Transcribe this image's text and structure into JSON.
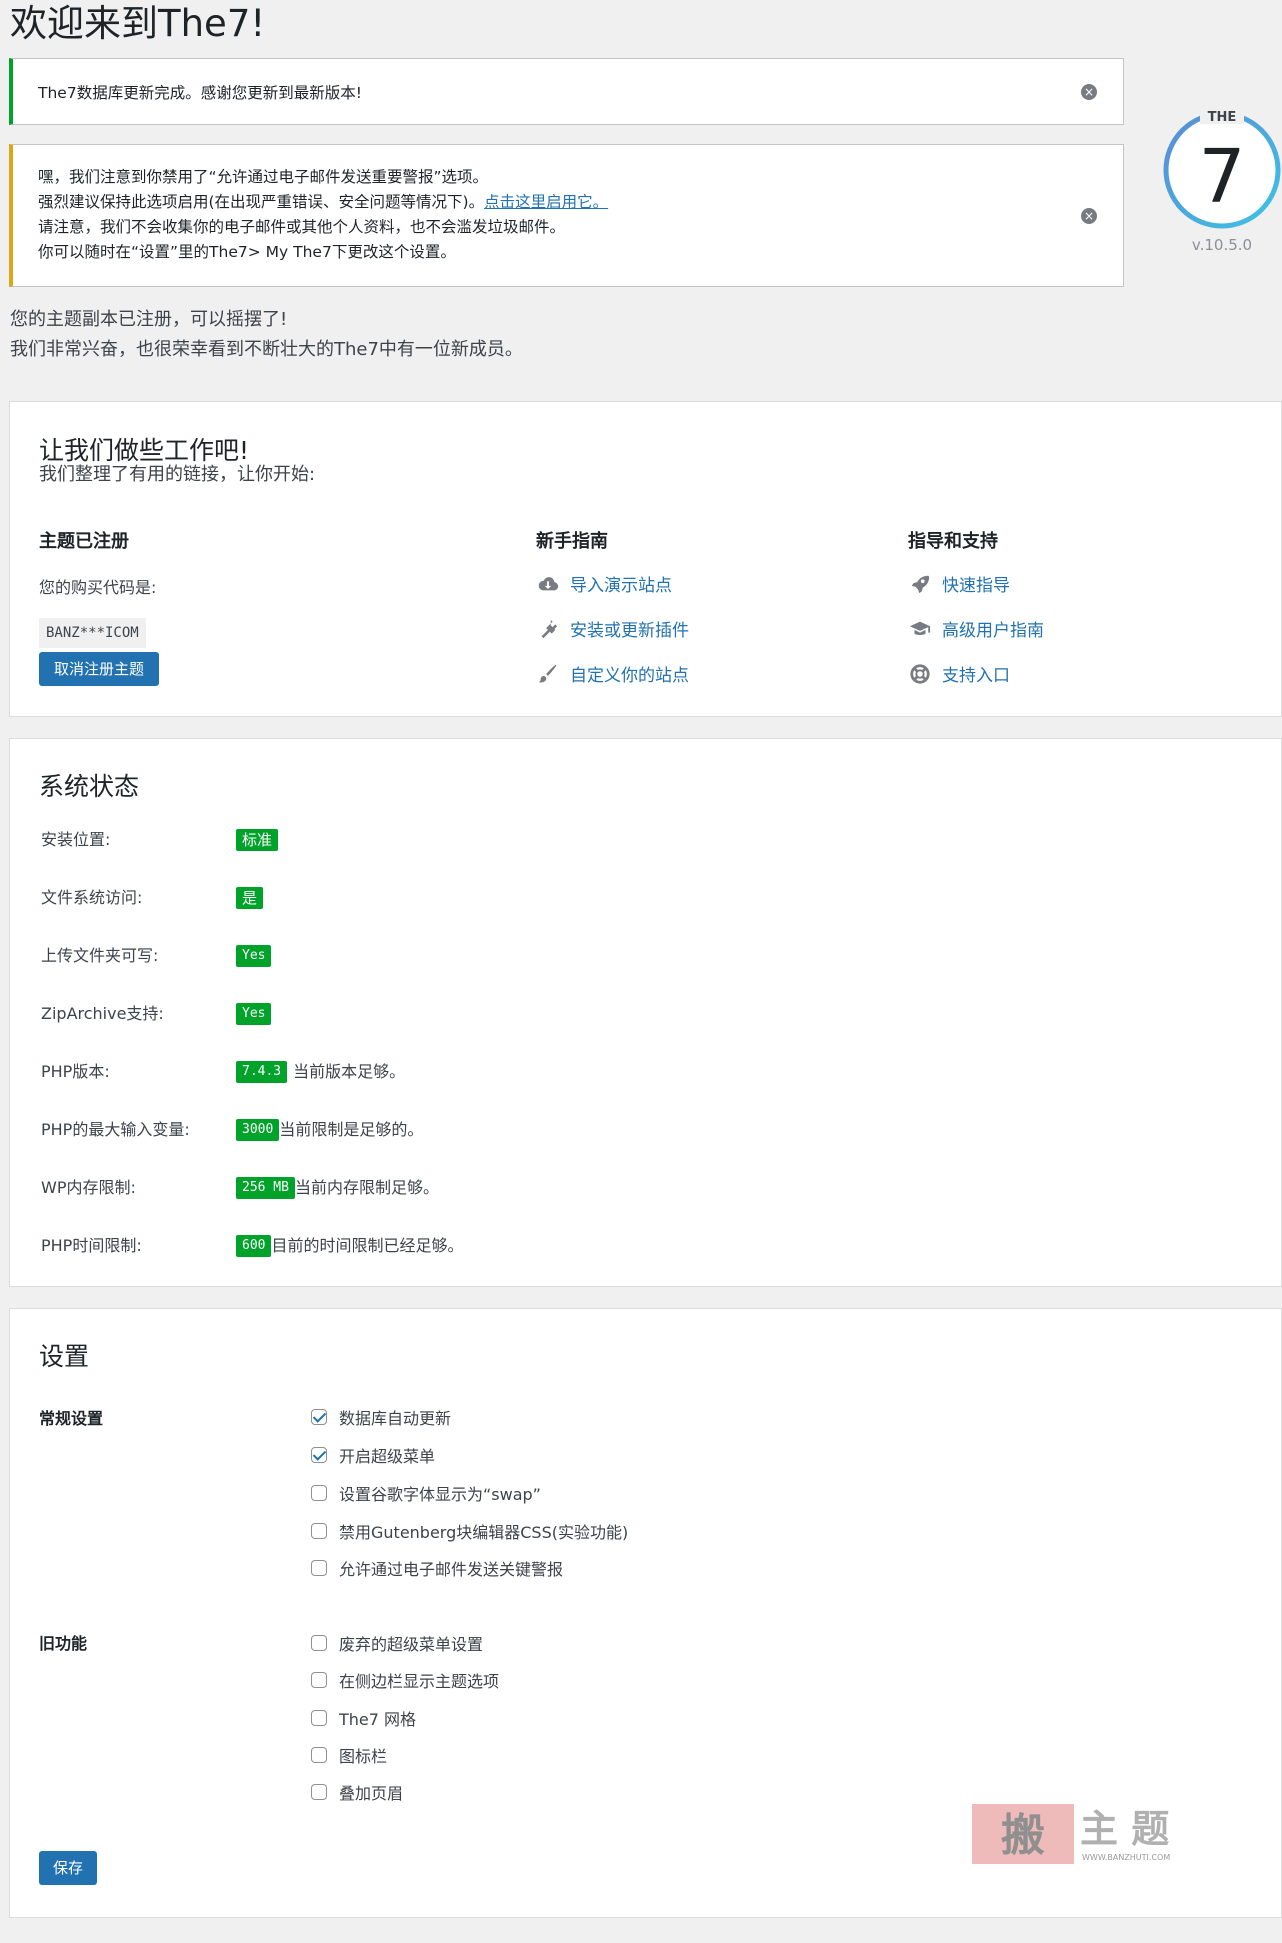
{
  "page": {
    "title": "欢迎来到The7!"
  },
  "logo": {
    "brand": "THE",
    "digit": "7",
    "version": "v.10.5.0"
  },
  "notices": {
    "success": {
      "text": "The7数据库更新完成。感谢您更新到最新版本!"
    },
    "warning": {
      "line1": "嘿，我们注意到你禁用了“允许通过电子邮件发送重要警报”选项。",
      "line2_pre": "强烈建议保持此选项启用(在出现严重错误、安全问题等情况下)。",
      "line2_link": "点击这里启用它。",
      "line3": "请注意，我们不会收集你的电子邮件或其他个人资料，也不会滥发垃圾邮件。",
      "line4": "你可以随时在“设置”里的The7> My The7下更改这个设置。"
    },
    "dismiss_glyph": "×"
  },
  "intro": {
    "line1": "您的主题副本已注册，可以摇摆了!",
    "line2": "我们非常兴奋，也很荣幸看到不断壮大的The7中有一位新成员。"
  },
  "work": {
    "title": "让我们做些工作吧!",
    "subtitle": "我们整理了有用的链接，让你开始:",
    "registered": {
      "heading": "主题已注册",
      "code_label": "您的购买代码是:",
      "code": "BANZ***ICOM",
      "button": "取消注册主题"
    },
    "guide": {
      "heading": "新手指南",
      "links": [
        {
          "label": "导入演示站点",
          "icon": "cloud-download-icon"
        },
        {
          "label": "安装或更新插件",
          "icon": "plugin-icon"
        },
        {
          "label": "自定义你的站点",
          "icon": "brush-icon"
        }
      ]
    },
    "support": {
      "heading": "指导和支持",
      "links": [
        {
          "label": "快速指导",
          "icon": "rocket-icon"
        },
        {
          "label": "高级用户指南",
          "icon": "graduation-cap-icon"
        },
        {
          "label": "支持入口",
          "icon": "lifebuoy-icon"
        }
      ]
    }
  },
  "status": {
    "title": "系统状态",
    "rows": [
      {
        "label": "安装位置:",
        "badge": "标准",
        "note": ""
      },
      {
        "label": "文件系统访问:",
        "badge": "是",
        "note": ""
      },
      {
        "label": "上传文件夹可写:",
        "badge": "Yes",
        "note": ""
      },
      {
        "label": "ZipArchive支持:",
        "badge": "Yes",
        "note": ""
      },
      {
        "label": "PHP版本:",
        "badge": "7.4.3",
        "note": "当前版本足够。"
      },
      {
        "label": "PHP的最大输入变量:",
        "badge": "3000",
        "note": "当前限制是足够的。"
      },
      {
        "label": "WP内存限制:",
        "badge": "256 MB",
        "note": "当前内存限制足够。"
      },
      {
        "label": "PHP时间限制:",
        "badge": "600",
        "note": "目前的时间限制已经足够。"
      }
    ]
  },
  "settings": {
    "title": "设置",
    "general": {
      "label": "常规设置",
      "options": [
        {
          "label": "数据库自动更新",
          "checked": true
        },
        {
          "label": "开启超级菜单",
          "checked": true
        },
        {
          "label": "设置谷歌字体显示为“swap”",
          "checked": false
        },
        {
          "label": "禁用Gutenberg块编辑器CSS(实验功能)",
          "checked": false
        },
        {
          "label": "允许通过电子邮件发送关键警报",
          "checked": false
        }
      ]
    },
    "legacy": {
      "label": "旧功能",
      "options": [
        {
          "label": "废弃的超级菜单设置",
          "checked": false
        },
        {
          "label": "在侧边栏显示主题选项",
          "checked": false
        },
        {
          "label": "The7 网格",
          "checked": false
        },
        {
          "label": "图标栏",
          "checked": false
        },
        {
          "label": "叠加页眉",
          "checked": false
        }
      ]
    },
    "save_button": "保存"
  },
  "watermark": {
    "main": "主 题",
    "seal": "搬",
    "url": "WWW.BANZHUTI.COM"
  },
  "colors": {
    "accent": "#2271b1",
    "success": "#00a32a",
    "warning": "#dba617",
    "logo_ring": "#3aa7e0"
  }
}
